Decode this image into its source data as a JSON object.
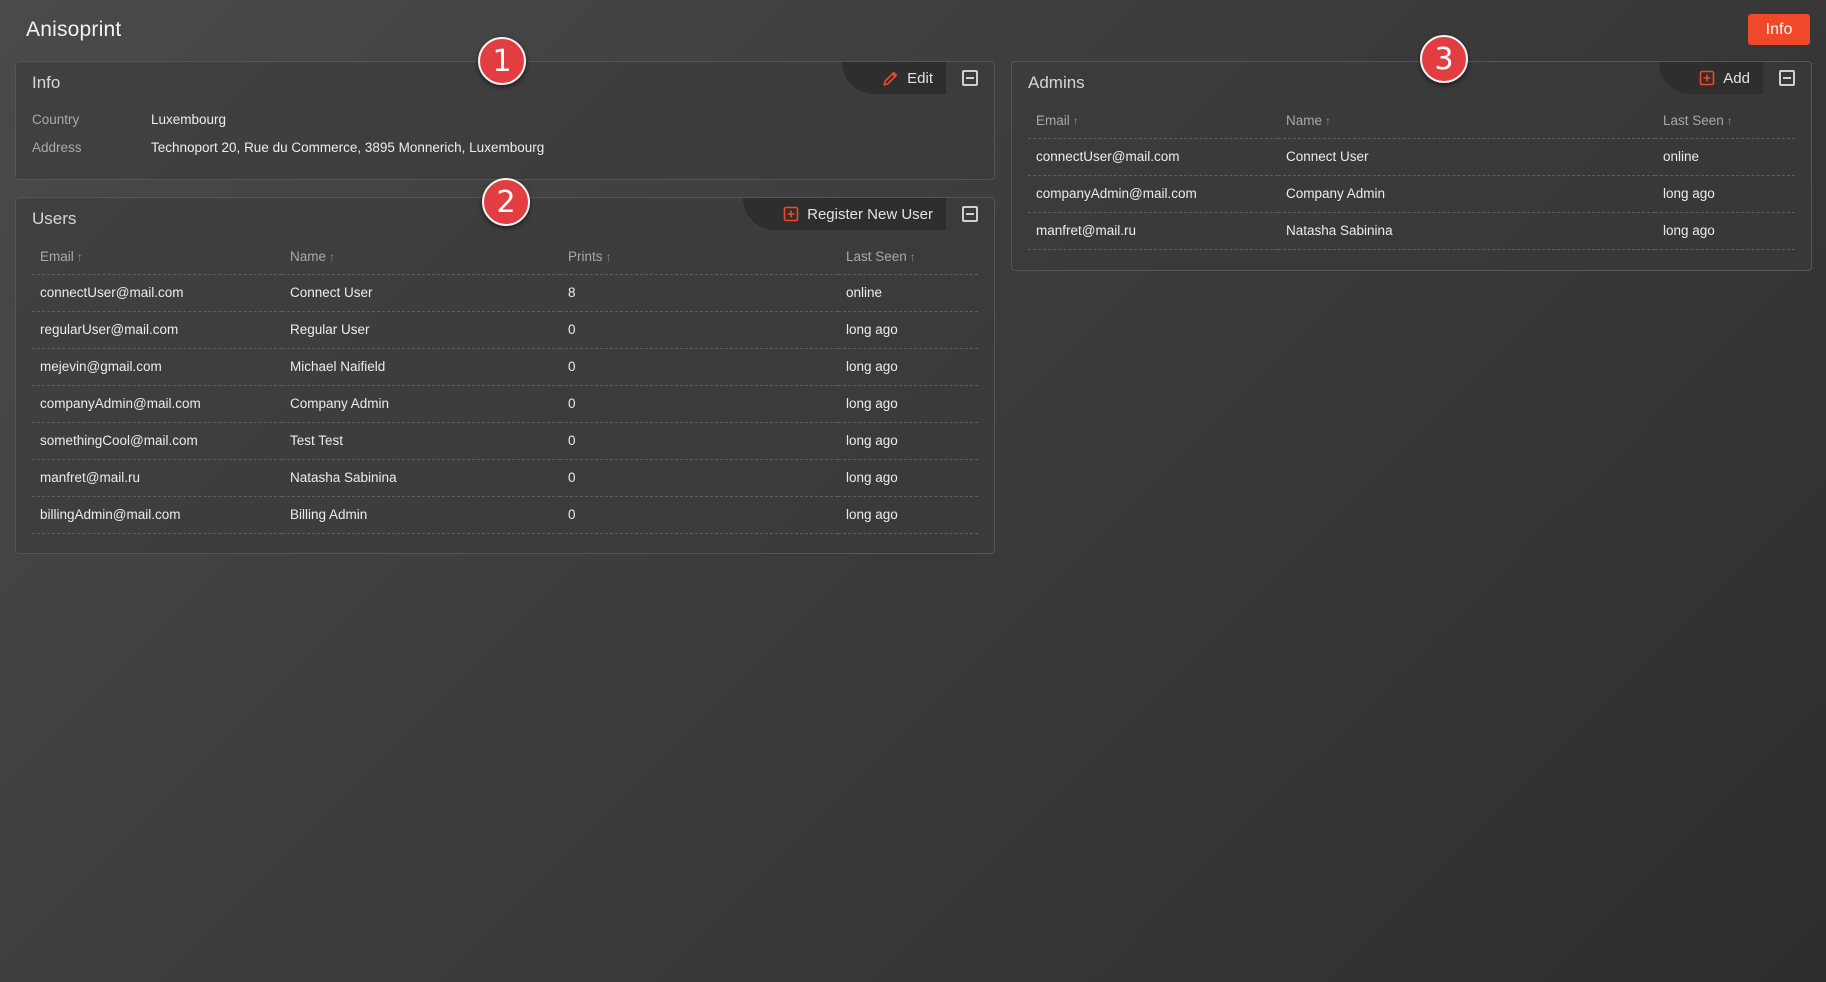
{
  "header": {
    "app_title": "Anisoprint",
    "info_button": "Info"
  },
  "colors": {
    "accent": "#f0492a",
    "badge": "#e23e42",
    "background": "#3c3c3c"
  },
  "info_panel": {
    "title": "Info",
    "action_label": "Edit",
    "action_icon": "pencil-icon",
    "fields": [
      {
        "label": "Country",
        "value": "Luxembourg"
      },
      {
        "label": "Address",
        "value": "Technoport 20, Rue du Commerce, 3895 Monnerich, Luxembourg"
      }
    ]
  },
  "users_panel": {
    "title": "Users",
    "action_label": "Register New User",
    "action_icon": "plus-square-icon",
    "columns": [
      "Email",
      "Name",
      "Prints",
      "Last Seen"
    ],
    "sort_icon": "↑",
    "rows": [
      {
        "email": "connectUser@mail.com",
        "name": "Connect User",
        "prints": "8",
        "last_seen": "online"
      },
      {
        "email": "regularUser@mail.com",
        "name": "Regular User",
        "prints": "0",
        "last_seen": "long ago"
      },
      {
        "email": "mejevin@gmail.com",
        "name": "Michael Naifield",
        "prints": "0",
        "last_seen": "long ago"
      },
      {
        "email": "companyAdmin@mail.com",
        "name": "Company Admin",
        "prints": "0",
        "last_seen": "long ago"
      },
      {
        "email": "somethingCool@mail.com",
        "name": "Test Test",
        "prints": "0",
        "last_seen": "long ago"
      },
      {
        "email": "manfret@mail.ru",
        "name": "Natasha Sabinina",
        "prints": "0",
        "last_seen": "long ago"
      },
      {
        "email": "billingAdmin@mail.com",
        "name": "Billing Admin",
        "prints": "0",
        "last_seen": "long ago"
      }
    ]
  },
  "admins_panel": {
    "title": "Admins",
    "action_label": "Add",
    "action_icon": "plus-square-icon",
    "columns": [
      "Email",
      "Name",
      "Last Seen"
    ],
    "sort_icon": "↑",
    "rows": [
      {
        "email": "connectUser@mail.com",
        "name": "Connect User",
        "last_seen": "online"
      },
      {
        "email": "companyAdmin@mail.com",
        "name": "Company Admin",
        "last_seen": "long ago"
      },
      {
        "email": "manfret@mail.ru",
        "name": "Natasha Sabinina",
        "last_seen": "long ago"
      }
    ]
  },
  "badges": [
    "1",
    "2",
    "3"
  ]
}
